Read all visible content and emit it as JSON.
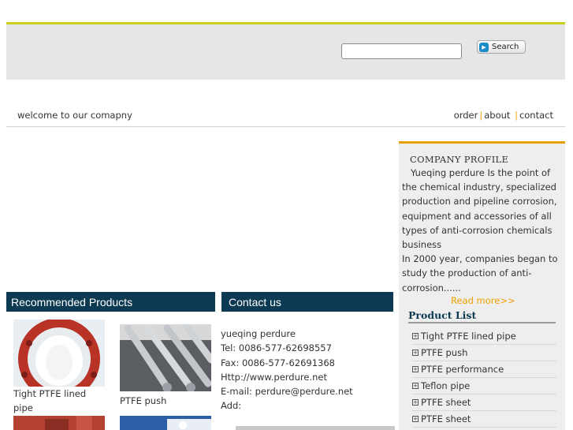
{
  "header": {
    "search_placeholder": "",
    "search_button_label": "Search"
  },
  "welcome_text": "welcome to our comapny",
  "nav": {
    "items": [
      "order",
      "about",
      "contact"
    ],
    "separator": "|"
  },
  "recommended": {
    "title": "Recommended Products",
    "products": [
      {
        "label": "Tight PTFE lined pipe",
        "icon": "lined-pipe-flange-image"
      },
      {
        "label": "PTFE push",
        "icon": "ptfe-pipes-image"
      }
    ]
  },
  "contact": {
    "title": "Contact us",
    "lines": [
      "yueqing perdure",
      "Tel: 0086-577-62698557",
      "Fax: 0086-577-62691368",
      "Http://www.perdure.net",
      "E-mail: perdure@perdure.net",
      "Add:"
    ]
  },
  "profile": {
    "title": "COMPANY PROFILE",
    "text_lines": [
      "   Yueqing perdure Is the point of",
      "the chemical industry, specialized",
      "production and pipeline corrosion,",
      "equipment and accessories of all",
      "types of anti-corrosion chemicals",
      "business",
      "In 2000 year, companies began to",
      "study the production of anti-",
      "corrosion......"
    ],
    "read_more": "Read more>>"
  },
  "product_list": {
    "title": "Product List",
    "items": [
      "Tight PTFE lined pipe",
      "PTFE push",
      "PTFE performance",
      "Teflon pipe",
      "PTFE sheet",
      "PTFE sheet"
    ]
  },
  "colors": {
    "accent_line": "#c8d21e",
    "panel_header": "#0c3a52",
    "orange": "#f0a000",
    "header_bg": "#e6e6e6"
  }
}
